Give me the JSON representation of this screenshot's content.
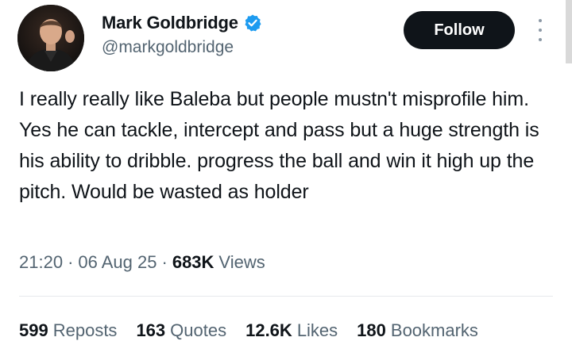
{
  "author": {
    "display_name": "Mark Goldbridge",
    "handle": "@markgoldbridge",
    "verified": true,
    "verified_color": "#1d9bf0"
  },
  "follow_button": {
    "label": "Follow",
    "background": "#0f1419"
  },
  "tweet": {
    "text": "I really really like Baleba but people mustn't misprofile him. Yes he can tackle, intercept and pass but a huge strength is his ability to dribble. progress the ball and win it high up the pitch. Would be wasted as holder"
  },
  "meta": {
    "time": "21:20",
    "separator": "·",
    "date": "06 Aug 25",
    "views_count": "683K",
    "views_label": "Views"
  },
  "stats": {
    "reposts": {
      "count": "599",
      "label": "Reposts"
    },
    "quotes": {
      "count": "163",
      "label": "Quotes"
    },
    "likes": {
      "count": "12.6K",
      "label": "Likes"
    },
    "bookmarks": {
      "count": "180",
      "label": "Bookmarks"
    }
  },
  "icons": {
    "verified": "verified-badge-icon",
    "more": "more-vertical-icon"
  }
}
